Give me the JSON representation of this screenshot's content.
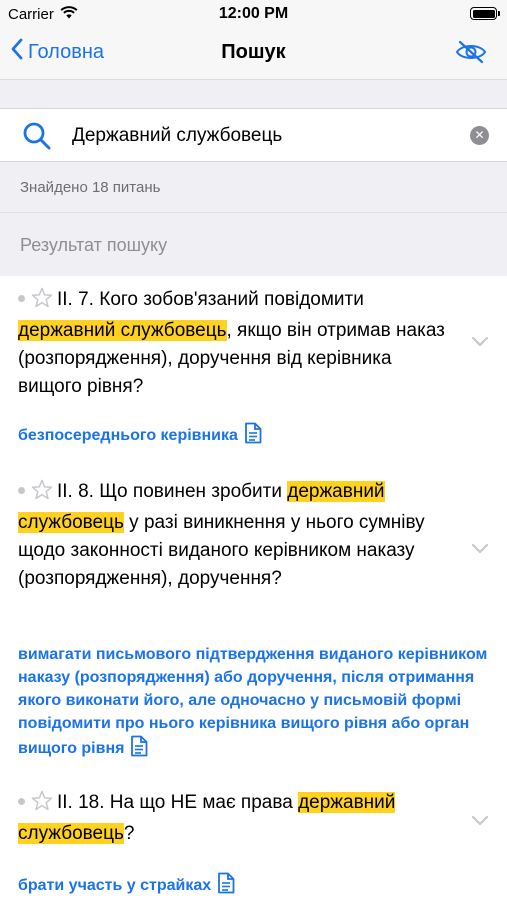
{
  "status_bar": {
    "carrier": "Carrier",
    "time": "12:00 PM"
  },
  "nav": {
    "back_label": "Головна",
    "title": "Пошук"
  },
  "search": {
    "value": "Державний службовець",
    "placeholder": ""
  },
  "found_text": "Знайдено 18 питань",
  "results_header": "Результат пошуку",
  "results": [
    {
      "number": "ІІ. 7.",
      "pre": " Кого зобов'язаний повідомити ",
      "highlight": "державний службовець",
      "post": ", якщо він отримав наказ (розпорядження), доручення від керівника вищого рівня?",
      "answer": "безпосереднього керівника"
    },
    {
      "number": "ІІ. 8.",
      "pre": " Що повинен зробити ",
      "highlight": "державний службовець",
      "post": " у разі виникнення у нього сумніву щодо законності виданого керівником наказу (розпорядження), доручення?",
      "answer": "вимагати письмового підтвердження виданого керівником наказу (розпорядження) або доручення, після отримання якого виконати його, але одночасно у письмовій формі повідомити про нього керівника вищого рівня або орган вищого рівня"
    },
    {
      "number": "ІІ. 18.",
      "pre": " На що НЕ має права ",
      "highlight": "державний службовець",
      "post": "?",
      "answer": "брати участь у страйках"
    }
  ],
  "colors": {
    "accent": "#1a73e8",
    "highlight": "#ffd21f",
    "secondary_text": "#6d6d72",
    "background_grouped": "#efeff4"
  },
  "icons": [
    "wifi-icon",
    "battery-icon",
    "chevron-left-icon",
    "eye-slash-icon",
    "search-icon",
    "clear-icon",
    "star-icon",
    "chevron-down-icon",
    "document-icon"
  ]
}
